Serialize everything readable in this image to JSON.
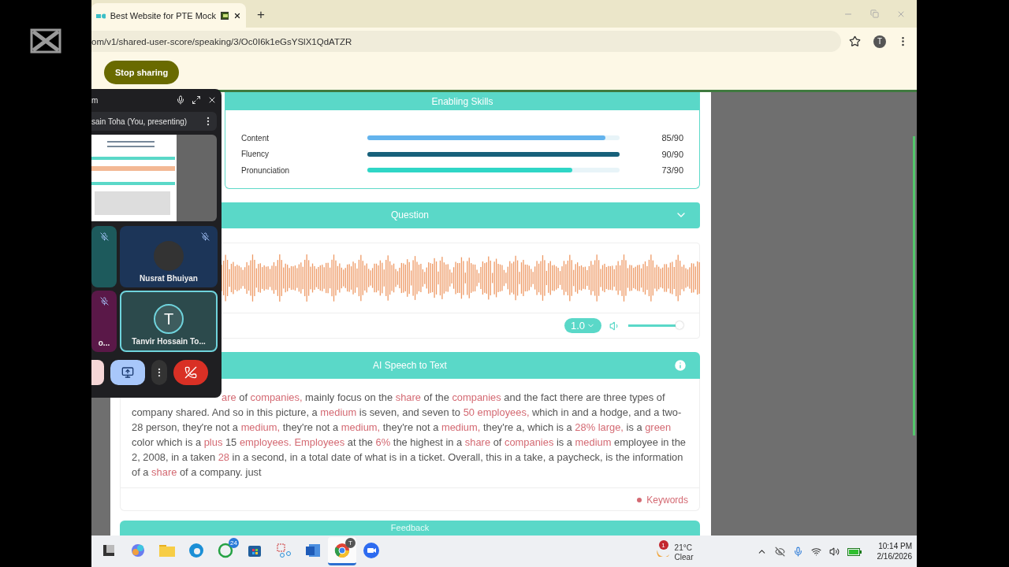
{
  "browser": {
    "tab": {
      "title": "Best Website for PTE Mock"
    },
    "new_tab": "+",
    "url": "om/v1/shared-user-score/speaking/3/Oc0I6k1eGsYSlX1QdATZR",
    "profile_initial": "T",
    "stop_sharing": "Stop sharing"
  },
  "skills": {
    "title": "Enabling Skills",
    "items": [
      {
        "name": "Content",
        "level": 0.944,
        "score": "85/90",
        "color": "#63b3ed"
      },
      {
        "name": "Fluency",
        "level": 1.0,
        "score": "90/90",
        "color": "#17607a"
      },
      {
        "name": "Pronunciation",
        "level": 0.811,
        "score": "73/90",
        "color": "#2fd6c6"
      }
    ]
  },
  "question": {
    "title": "Question",
    "expanded": false
  },
  "player": {
    "speed": "1.0",
    "volume": {
      "level": 0.95
    }
  },
  "speech_to_text": {
    "title": "AI Speech to Text",
    "segments": [
      {
        "text": "are",
        "keyword": true
      },
      {
        "text": " of ",
        "keyword": false
      },
      {
        "text": "companies,",
        "keyword": true
      },
      {
        "text": " mainly focus on the ",
        "keyword": false
      },
      {
        "text": "share",
        "keyword": true
      },
      {
        "text": " of the ",
        "keyword": false
      },
      {
        "text": "companies",
        "keyword": true
      },
      {
        "text": " and the fact there are three types of company shared. And so in this picture, a ",
        "keyword": false
      },
      {
        "text": "medium",
        "keyword": true
      },
      {
        "text": " is seven, and seven to ",
        "keyword": false
      },
      {
        "text": "50 employees,",
        "keyword": true
      },
      {
        "text": " which in and a hodge, and a two-28 person, they're not a ",
        "keyword": false
      },
      {
        "text": "medium,",
        "keyword": true
      },
      {
        "text": " they're not a ",
        "keyword": false
      },
      {
        "text": "medium,",
        "keyword": true
      },
      {
        "text": " they're not a ",
        "keyword": false
      },
      {
        "text": "medium,",
        "keyword": true
      },
      {
        "text": " they're a, which is a ",
        "keyword": false
      },
      {
        "text": "28% large,",
        "keyword": true
      },
      {
        "text": " is a ",
        "keyword": false
      },
      {
        "text": "green",
        "keyword": true
      },
      {
        "text": " color which is a ",
        "keyword": false
      },
      {
        "text": "plus",
        "keyword": true
      },
      {
        "text": " 15 ",
        "keyword": false
      },
      {
        "text": "employees. Employees",
        "keyword": true
      },
      {
        "text": " at the ",
        "keyword": false
      },
      {
        "text": "6%",
        "keyword": true
      },
      {
        "text": " the highest in a ",
        "keyword": false
      },
      {
        "text": "share",
        "keyword": true
      },
      {
        "text": " of ",
        "keyword": false
      },
      {
        "text": "companies",
        "keyword": true
      },
      {
        "text": " is a ",
        "keyword": false
      },
      {
        "text": "medium",
        "keyword": true
      },
      {
        "text": " employee in the 2, 2008, in a taken ",
        "keyword": false
      },
      {
        "text": "28",
        "keyword": true
      },
      {
        "text": " in a second, in a total date of what is in a ticket. Overall, this in a take, a paycheck, is the information of a ",
        "keyword": false
      },
      {
        "text": "share",
        "keyword": true
      },
      {
        "text": " of a company. just",
        "keyword": false
      }
    ],
    "legend": "Keywords"
  },
  "feedback": {
    "title": "Feedback"
  },
  "meet": {
    "title": "m",
    "presenter": "sain Toha (You, presenting)",
    "tiles": [
      {
        "kind": "blank",
        "muted": true,
        "selected": false,
        "color": "#1d5a5c"
      },
      {
        "kind": "photo",
        "name": "Nusrat Bhuiyan",
        "muted": true,
        "selected": false,
        "color": "#1c3558"
      },
      {
        "kind": "blank",
        "name": "o...",
        "muted": true,
        "selected": false,
        "color": "#5a1848"
      },
      {
        "kind": "initial",
        "name": "Tanvir Hossain To...",
        "initial": "T",
        "muted": false,
        "selected": true,
        "color": "#2c4a4c"
      }
    ]
  },
  "taskbar": {
    "apps": [
      {
        "kind": "start",
        "selected": false
      },
      {
        "kind": "copilot",
        "selected": false
      },
      {
        "kind": "files",
        "selected": false
      },
      {
        "kind": "edge",
        "selected": false
      },
      {
        "kind": "whatsapp",
        "badge": "24",
        "selected": false
      },
      {
        "kind": "store",
        "selected": false
      },
      {
        "kind": "snip",
        "selected": false
      },
      {
        "kind": "word",
        "selected": false
      },
      {
        "kind": "chrome",
        "badge": "T",
        "selected": true
      },
      {
        "kind": "zoom",
        "selected": false
      }
    ],
    "weather": {
      "badge": "1",
      "temp": "21°C",
      "condition": "Clear"
    },
    "clock": {
      "time": "10:14 PM",
      "date": "2/16/2026"
    }
  }
}
